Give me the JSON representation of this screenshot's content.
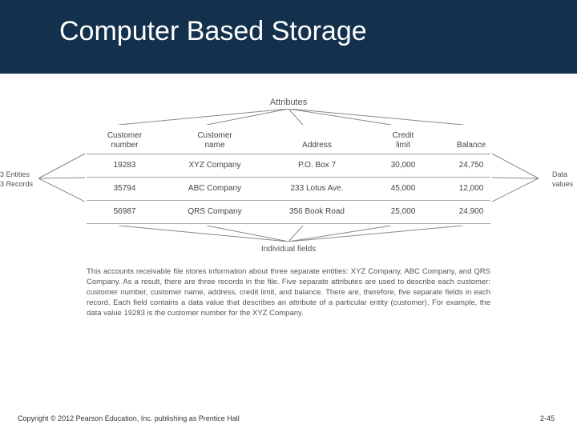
{
  "title": "Computer Based Storage",
  "labels": {
    "attributes": "Attributes",
    "individual_fields": "Individual fields",
    "entities_line1": "3 Entities",
    "entities_line2": "3 Records",
    "data_line1": "Data",
    "data_line2": "values"
  },
  "columns": [
    {
      "line1": "Customer",
      "line2": "number"
    },
    {
      "line1": "Customer",
      "line2": "name"
    },
    {
      "line1": "Address",
      "line2": ""
    },
    {
      "line1": "Credit",
      "line2": "limit"
    },
    {
      "line1": "Balance",
      "line2": ""
    }
  ],
  "rows": [
    {
      "c0": "19283",
      "c1": "XYZ Company",
      "c2": "P.O. Box 7",
      "c3": "30,000",
      "c4": "24,750"
    },
    {
      "c0": "35794",
      "c1": "ABC Company",
      "c2": "233 Lotus Ave.",
      "c3": "45,000",
      "c4": "12,000"
    },
    {
      "c0": "56987",
      "c1": "QRS Company",
      "c2": "356 Book Road",
      "c3": "25,000",
      "c4": "24,900"
    }
  ],
  "caption": "This accounts receivable file stores information about three separate entities: XYZ Company, ABC Company, and QRS Company. As a result, there are three records in the file. Five separate attributes are used to describe each customer: customer number, customer name, address, credit limit, and balance. There are, therefore, five separate fields in each record. Each field contains a data value that describes an attribute of a particular entity (customer). For example, the data value 19283 is the customer number for the XYZ Company.",
  "footer": {
    "copyright": "Copyright © 2012 Pearson Education, Inc. publishing as Prentice Hall",
    "page": "2-45"
  }
}
